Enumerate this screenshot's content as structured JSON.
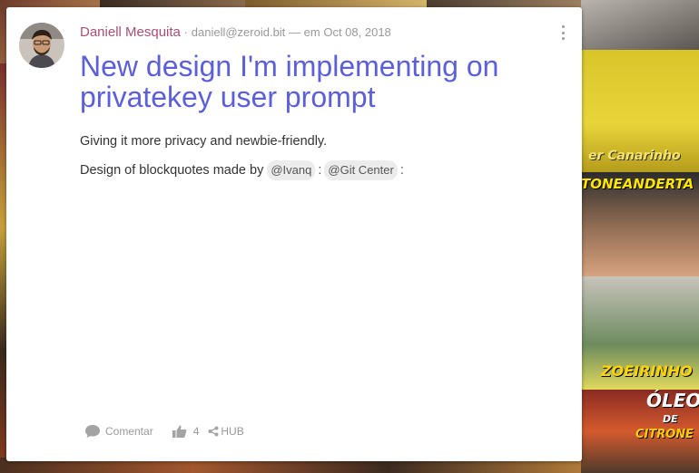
{
  "post": {
    "author": "Daniell Mesquita",
    "meta_separator": "·",
    "email": "daniell@zeroid.bit",
    "date": "— em Oct 08, 2018",
    "title": "New design I'm implementing on privatekey user prompt",
    "body_line1": "Giving it more privacy and newbie-friendly.",
    "body_line2_prefix": "Design of blockquotes made by",
    "mentions": [
      "@Ivanq",
      "@Git Center"
    ],
    "mention_separator": ":",
    "trailing_separator": ":"
  },
  "actions": {
    "comment_label": "Comentar",
    "like_count": "4",
    "share_label": "HUB"
  },
  "background": {
    "captions": [
      "er Canarinho",
      "TONEANDERTA",
      "ZOEIRINHO",
      "ÓLEO",
      "DE",
      "CITRONE"
    ]
  },
  "icons": {
    "menu": "vertical-dots-icon",
    "comment": "speech-bubble-icon",
    "like": "thumbs-up-icon",
    "share": "share-icon"
  },
  "colors": {
    "author": "#a84f76",
    "title": "#5b5fd9",
    "muted": "#999999"
  }
}
